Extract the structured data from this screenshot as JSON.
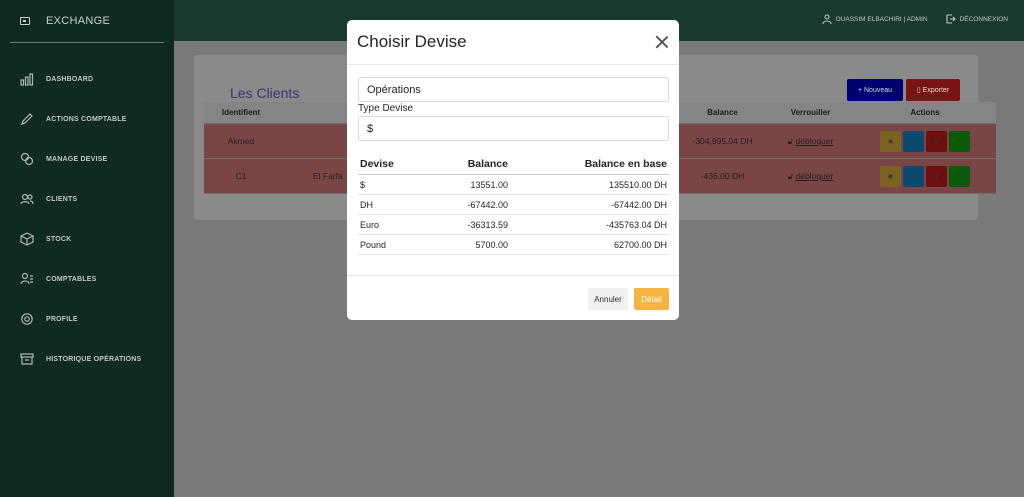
{
  "brand": {
    "name": "EXCHANGE"
  },
  "sidebar": {
    "items": [
      {
        "label": "DASHBOARD",
        "icon": "bar-chart-icon"
      },
      {
        "label": "ACTIONS COMPTABLE",
        "icon": "pencil-icon"
      },
      {
        "label": "MANAGE DEVISE",
        "icon": "coins-icon"
      },
      {
        "label": "CLIENTS",
        "icon": "users-icon"
      },
      {
        "label": "STOCK",
        "icon": "box-icon"
      },
      {
        "label": "COMPTABLES",
        "icon": "user-list-icon"
      },
      {
        "label": "PROFILE",
        "icon": "gear-icon"
      },
      {
        "label": "HISTORIQUE OPÉRATIONS",
        "icon": "archive-icon"
      }
    ]
  },
  "topbar": {
    "user": "OUASSIM ELBACHIRI | ADMIN",
    "logout": "DÉCONNEXION"
  },
  "page": {
    "title": "Les Clients",
    "new_button": "Nouveau",
    "export_button": "Exporter",
    "table": {
      "headers": [
        "Identifient",
        "",
        "Balance",
        "Verrouiller",
        "Actions"
      ],
      "rows": [
        {
          "id": "Akmed",
          "name": "",
          "balance": "-304,995.04 DH",
          "lock": "débloquer"
        },
        {
          "id": "C1",
          "name": "El Farfa",
          "balance": "-436.00 DH",
          "lock": "débloquer"
        }
      ]
    }
  },
  "modal": {
    "title": "Choisir Devise",
    "operations_value": "Opérations",
    "type_label": "Type Devise",
    "type_value": "$",
    "table": {
      "headers": [
        "Devise",
        "Balance",
        "Balance en base"
      ],
      "rows": [
        [
          "$",
          "13551.00",
          "135510.00 DH"
        ],
        [
          "DH",
          "-67442.00",
          "-67442.00 DH"
        ],
        [
          "Euro",
          "-36313.59",
          "-435763.04 DH"
        ],
        [
          "Pound",
          "5700.00",
          "62700.00 DH"
        ]
      ]
    },
    "cancel": "Annuler",
    "detail": "Détail"
  }
}
